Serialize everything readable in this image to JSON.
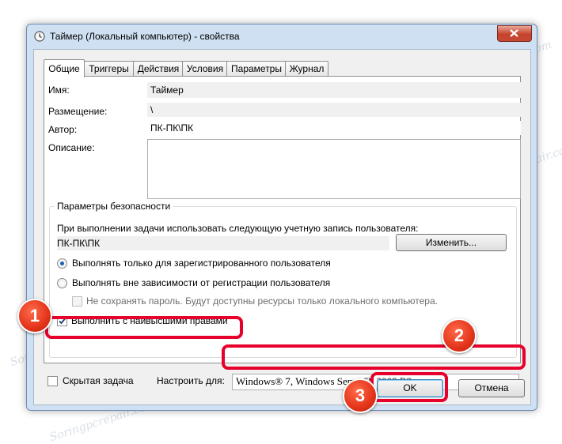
{
  "window": {
    "title": "Таймер (Локальный компьютер) - свойства"
  },
  "tabs": [
    "Общие",
    "Триггеры",
    "Действия",
    "Условия",
    "Параметры",
    "Журнал"
  ],
  "general": {
    "name_label": "Имя:",
    "name_value": "Таймер",
    "location_label": "Размещение:",
    "location_value": "\\",
    "author_label": "Автор:",
    "author_value": "ПК-ПК\\ПК",
    "description_label": "Описание:",
    "description_value": ""
  },
  "security": {
    "group_title": "Параметры безопасности",
    "account_prompt": "При выполнении задачи использовать следующую учетную запись пользователя:",
    "account_value": "ПК-ПК\\ПК",
    "change_button": "Изменить...",
    "radio_logged_on": "Выполнять только для зарегистрированного пользователя",
    "radio_logged_on_selected": true,
    "radio_any": "Выполнять вне зависимости от регистрации пользователя",
    "no_store_password": "Не сохранять пароль. Будут доступны ресурсы только локального компьютера.",
    "highest_privileges": "Выполнить с наивысшими правами",
    "highest_privileges_checked": true
  },
  "bottom": {
    "hidden_label": "Скрытая задача",
    "configure_label": "Настроить для:",
    "configure_value": "Windows® 7, Windows Server™ 2008 R2"
  },
  "buttons": {
    "ok": "OK",
    "cancel": "Отмена"
  },
  "badges": [
    "1",
    "2",
    "3"
  ],
  "watermark": "Soringpcrepair.com",
  "colors": {
    "highlight": "#e8002d",
    "badge": "#e3341a",
    "selected_radio": "#1b61b5"
  }
}
